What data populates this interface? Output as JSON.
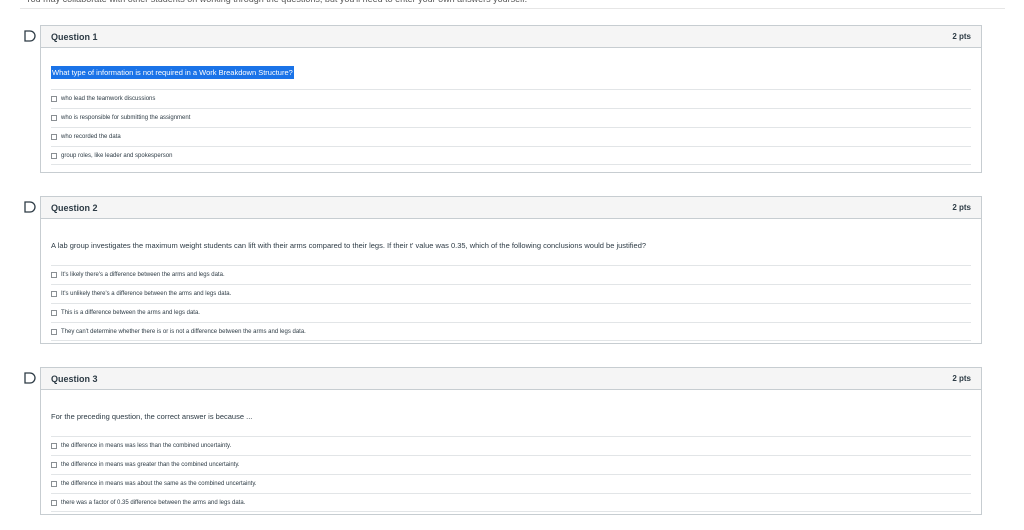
{
  "top_note": "• You may collaborate with other students on working through the questions, but you'll need to enter your own answers yourself.",
  "questions": [
    {
      "title": "Question 1",
      "points": "2 pts",
      "text": "What type of information is not required in a Work Breakdown Structure?",
      "answers": [
        "who lead the teamwork discussions",
        "who is responsible for submitting the assignment",
        "who recorded the data",
        "group roles, like leader and spokesperson"
      ]
    },
    {
      "title": "Question 2",
      "points": "2 pts",
      "text": "A lab group investigates the maximum weight students can lift with their arms compared to their legs. If their t' value was 0.35, which of the following conclusions would be justified?",
      "answers": [
        "It's likely there's a difference between the arms and legs data.",
        "It's unlikely there's a difference between the arms and legs data.",
        "This is a difference between the arms and legs data.",
        "They can't determine whether there is or is not a difference between the arms and legs data."
      ]
    },
    {
      "title": "Question 3",
      "points": "2 pts",
      "text": "For the preceding question, the correct answer is because ...",
      "answers": [
        "the difference in means was less than the combined uncertainty.",
        "the difference in means was greater than the combined uncertainty.",
        "the difference in means was about the same as the combined uncertainty.",
        "there was a factor of 0.35 difference between the arms and legs data."
      ]
    }
  ]
}
